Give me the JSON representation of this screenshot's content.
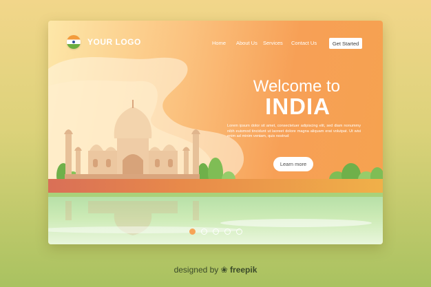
{
  "brand": {
    "logo_text": "YOUR LOGO",
    "flag_icon": "india-flag-icon"
  },
  "nav": {
    "items": [
      {
        "label": "Home"
      },
      {
        "label": "About Us"
      },
      {
        "label": "Services"
      },
      {
        "label": "Contact Us"
      }
    ],
    "cta_label": "Get Started"
  },
  "hero": {
    "title_line1": "Welcome to",
    "title_line2": "INDIA",
    "body": "Lorem ipsum dolor sit amet, consectetuer adipiscing elit, sed diam nonummy nibh euismod tincidunt ut laoreet dolore magna aliquam erat volutpat. Ut wisi enim ad minim veniam, quis nostrud",
    "button_label": "Learn more"
  },
  "slider": {
    "count": 5,
    "active_index": 0
  },
  "footer": {
    "credit_prefix": "designed by",
    "credit_brand": "freepik"
  },
  "colors": {
    "card_start": "#fde7a8",
    "card_end": "#f6a24f",
    "accent": "#f7a456",
    "background_top": "#f2d68a",
    "background_bottom": "#a9c260"
  }
}
